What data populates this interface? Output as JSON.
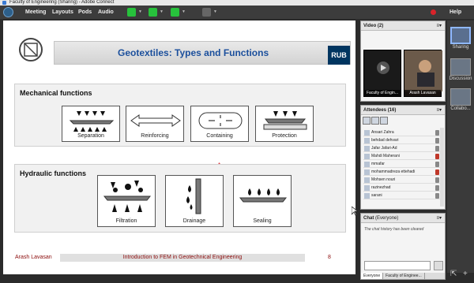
{
  "window": {
    "title": "Faculty of Engineering (Sharing) - Adobe Connect"
  },
  "menu": {
    "items": [
      "Meeting",
      "Layouts",
      "Pods",
      "Audio"
    ],
    "help": "Help"
  },
  "slide": {
    "title": "Geotextiles: Types and Functions",
    "logo_text": "RUB",
    "mechanical": {
      "title": "Mechanical functions",
      "items": [
        "Separation",
        "Reinforcing",
        "Containing",
        "Protection"
      ]
    },
    "hydraulic": {
      "title": "Hydraulic functions",
      "items": [
        "Filtration",
        "Drainage",
        "Sealing"
      ]
    },
    "footer": {
      "author": "Arash Lavasan",
      "course": "Introduction to FEM in Geotechnical Engineering",
      "page": "8"
    }
  },
  "video": {
    "title": "Video",
    "count": "(2)",
    "tiles": [
      "Faculty of Engin...",
      "Arash Lavasan"
    ]
  },
  "attendees": {
    "title": "Attendees",
    "count": "(16)",
    "list": [
      "Ansari Zahra",
      "behdad dehvari",
      "Jafar Jafari-Ad",
      "Mahdi Maherani",
      "mmafar",
      "mohammadreza ettehadi",
      "Mohsen nouri",
      "razinezhad",
      "sarani"
    ]
  },
  "chat": {
    "title": "Chat",
    "scope": "(Everyone)",
    "history": "The chat history has been cleared",
    "tabs": [
      "Everyone",
      "Faculty of Enginee..."
    ]
  },
  "sidebar": {
    "items": [
      "Sharing",
      "Discussion",
      "Collabo..."
    ]
  }
}
